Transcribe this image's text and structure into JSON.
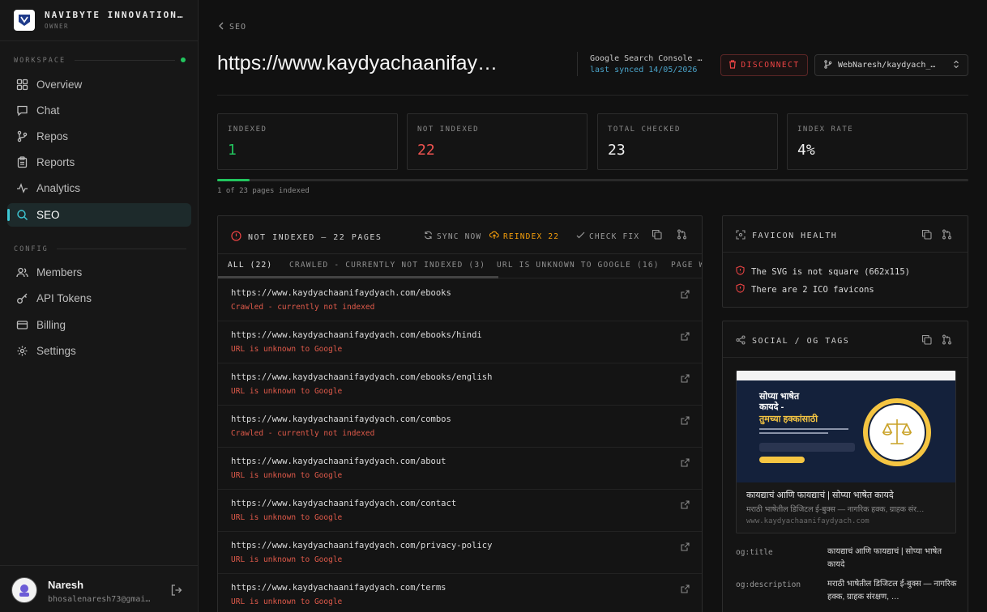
{
  "org": {
    "name": "NAVIBYTE INNOVATIONS…",
    "role": "OWNER"
  },
  "sidebar": {
    "workspace_label": "WORKSPACE",
    "config_label": "CONFIG",
    "workspace_items": [
      {
        "label": "Overview",
        "icon": "grid-icon"
      },
      {
        "label": "Chat",
        "icon": "chat-icon"
      },
      {
        "label": "Repos",
        "icon": "git-branch-icon"
      },
      {
        "label": "Reports",
        "icon": "clipboard-icon"
      },
      {
        "label": "Analytics",
        "icon": "activity-icon"
      },
      {
        "label": "SEO",
        "icon": "search-icon",
        "active": true
      }
    ],
    "config_items": [
      {
        "label": "Members",
        "icon": "users-icon"
      },
      {
        "label": "API Tokens",
        "icon": "key-icon"
      },
      {
        "label": "Billing",
        "icon": "credit-card-icon"
      },
      {
        "label": "Settings",
        "icon": "gear-icon"
      }
    ]
  },
  "user": {
    "name": "Naresh",
    "email": "bhosalenaresh73@gmai…"
  },
  "header": {
    "back_label": "SEO",
    "title": "https://www.kaydyachaanifay…",
    "gsc_name": "Google Search Console …",
    "gsc_sync": "last synced 14/05/2026",
    "disconnect_label": "DISCONNECT",
    "repo_label": "WebNaresh/kaydyach_…"
  },
  "stats": [
    {
      "label": "INDEXED",
      "value": "1",
      "color": "#22c55e"
    },
    {
      "label": "NOT INDEXED",
      "value": "22",
      "color": "#ef5350"
    },
    {
      "label": "TOTAL CHECKED",
      "value": "23",
      "color": "#f0f0f0"
    },
    {
      "label": "INDEX RATE",
      "value": "4%",
      "color": "#f0f0f0"
    }
  ],
  "progress": {
    "fraction": 0.043,
    "text": "1 of 23 pages indexed"
  },
  "not_indexed": {
    "title": "NOT INDEXED — 22 PAGES",
    "sync_label": "SYNC NOW",
    "reindex_label": "REINDEX 22",
    "check_label": "CHECK FIX",
    "tabs": [
      "ALL (22)",
      "CRAWLED - CURRENTLY NOT INDEXED (3)",
      "URL IS UNKNOWN TO GOOGLE (16)",
      "PAGE W"
    ],
    "rows": [
      {
        "url": "https://www.kaydyachaanifaydyach.com/ebooks",
        "status": "Crawled - currently not indexed"
      },
      {
        "url": "https://www.kaydyachaanifaydyach.com/ebooks/hindi",
        "status": "URL is unknown to Google"
      },
      {
        "url": "https://www.kaydyachaanifaydyach.com/ebooks/english",
        "status": "URL is unknown to Google"
      },
      {
        "url": "https://www.kaydyachaanifaydyach.com/combos",
        "status": "Crawled - currently not indexed"
      },
      {
        "url": "https://www.kaydyachaanifaydyach.com/about",
        "status": "URL is unknown to Google"
      },
      {
        "url": "https://www.kaydyachaanifaydyach.com/contact",
        "status": "URL is unknown to Google"
      },
      {
        "url": "https://www.kaydyachaanifaydyach.com/privacy-policy",
        "status": "URL is unknown to Google"
      },
      {
        "url": "https://www.kaydyachaanifaydyach.com/terms",
        "status": "URL is unknown to Google"
      }
    ]
  },
  "favicon": {
    "title": "FAVICON HEALTH",
    "issues": [
      "The SVG is not square (662x115)",
      "There are 2 ICO favicons"
    ]
  },
  "og": {
    "title": "SOCIAL / OG TAGS",
    "image_heading_1": "सोप्या भाषेत",
    "image_heading_2": "कायदे -",
    "image_heading_3": "तुमच्या हक्कांसाठी",
    "card_title": "कायद्याचं आणि फायद्याचं | सोप्या भाषेत कायदे",
    "card_desc": "मराठी भाषेतील डिजिटल ई-बुक्स — नागरिक हक्क, ग्राहक संर…",
    "card_domain": "www.kaydyachaanifaydyach.com",
    "fields": [
      {
        "key": "og:title",
        "value": "कायद्याचं आणि फायद्याचं | सोप्या भाषेत कायदे"
      },
      {
        "key": "og:description",
        "value": "मराठी भाषेतील डिजिटल ई-बुक्स — नागरिक हक्क, ग्राहक संरक्षण, …"
      }
    ]
  }
}
